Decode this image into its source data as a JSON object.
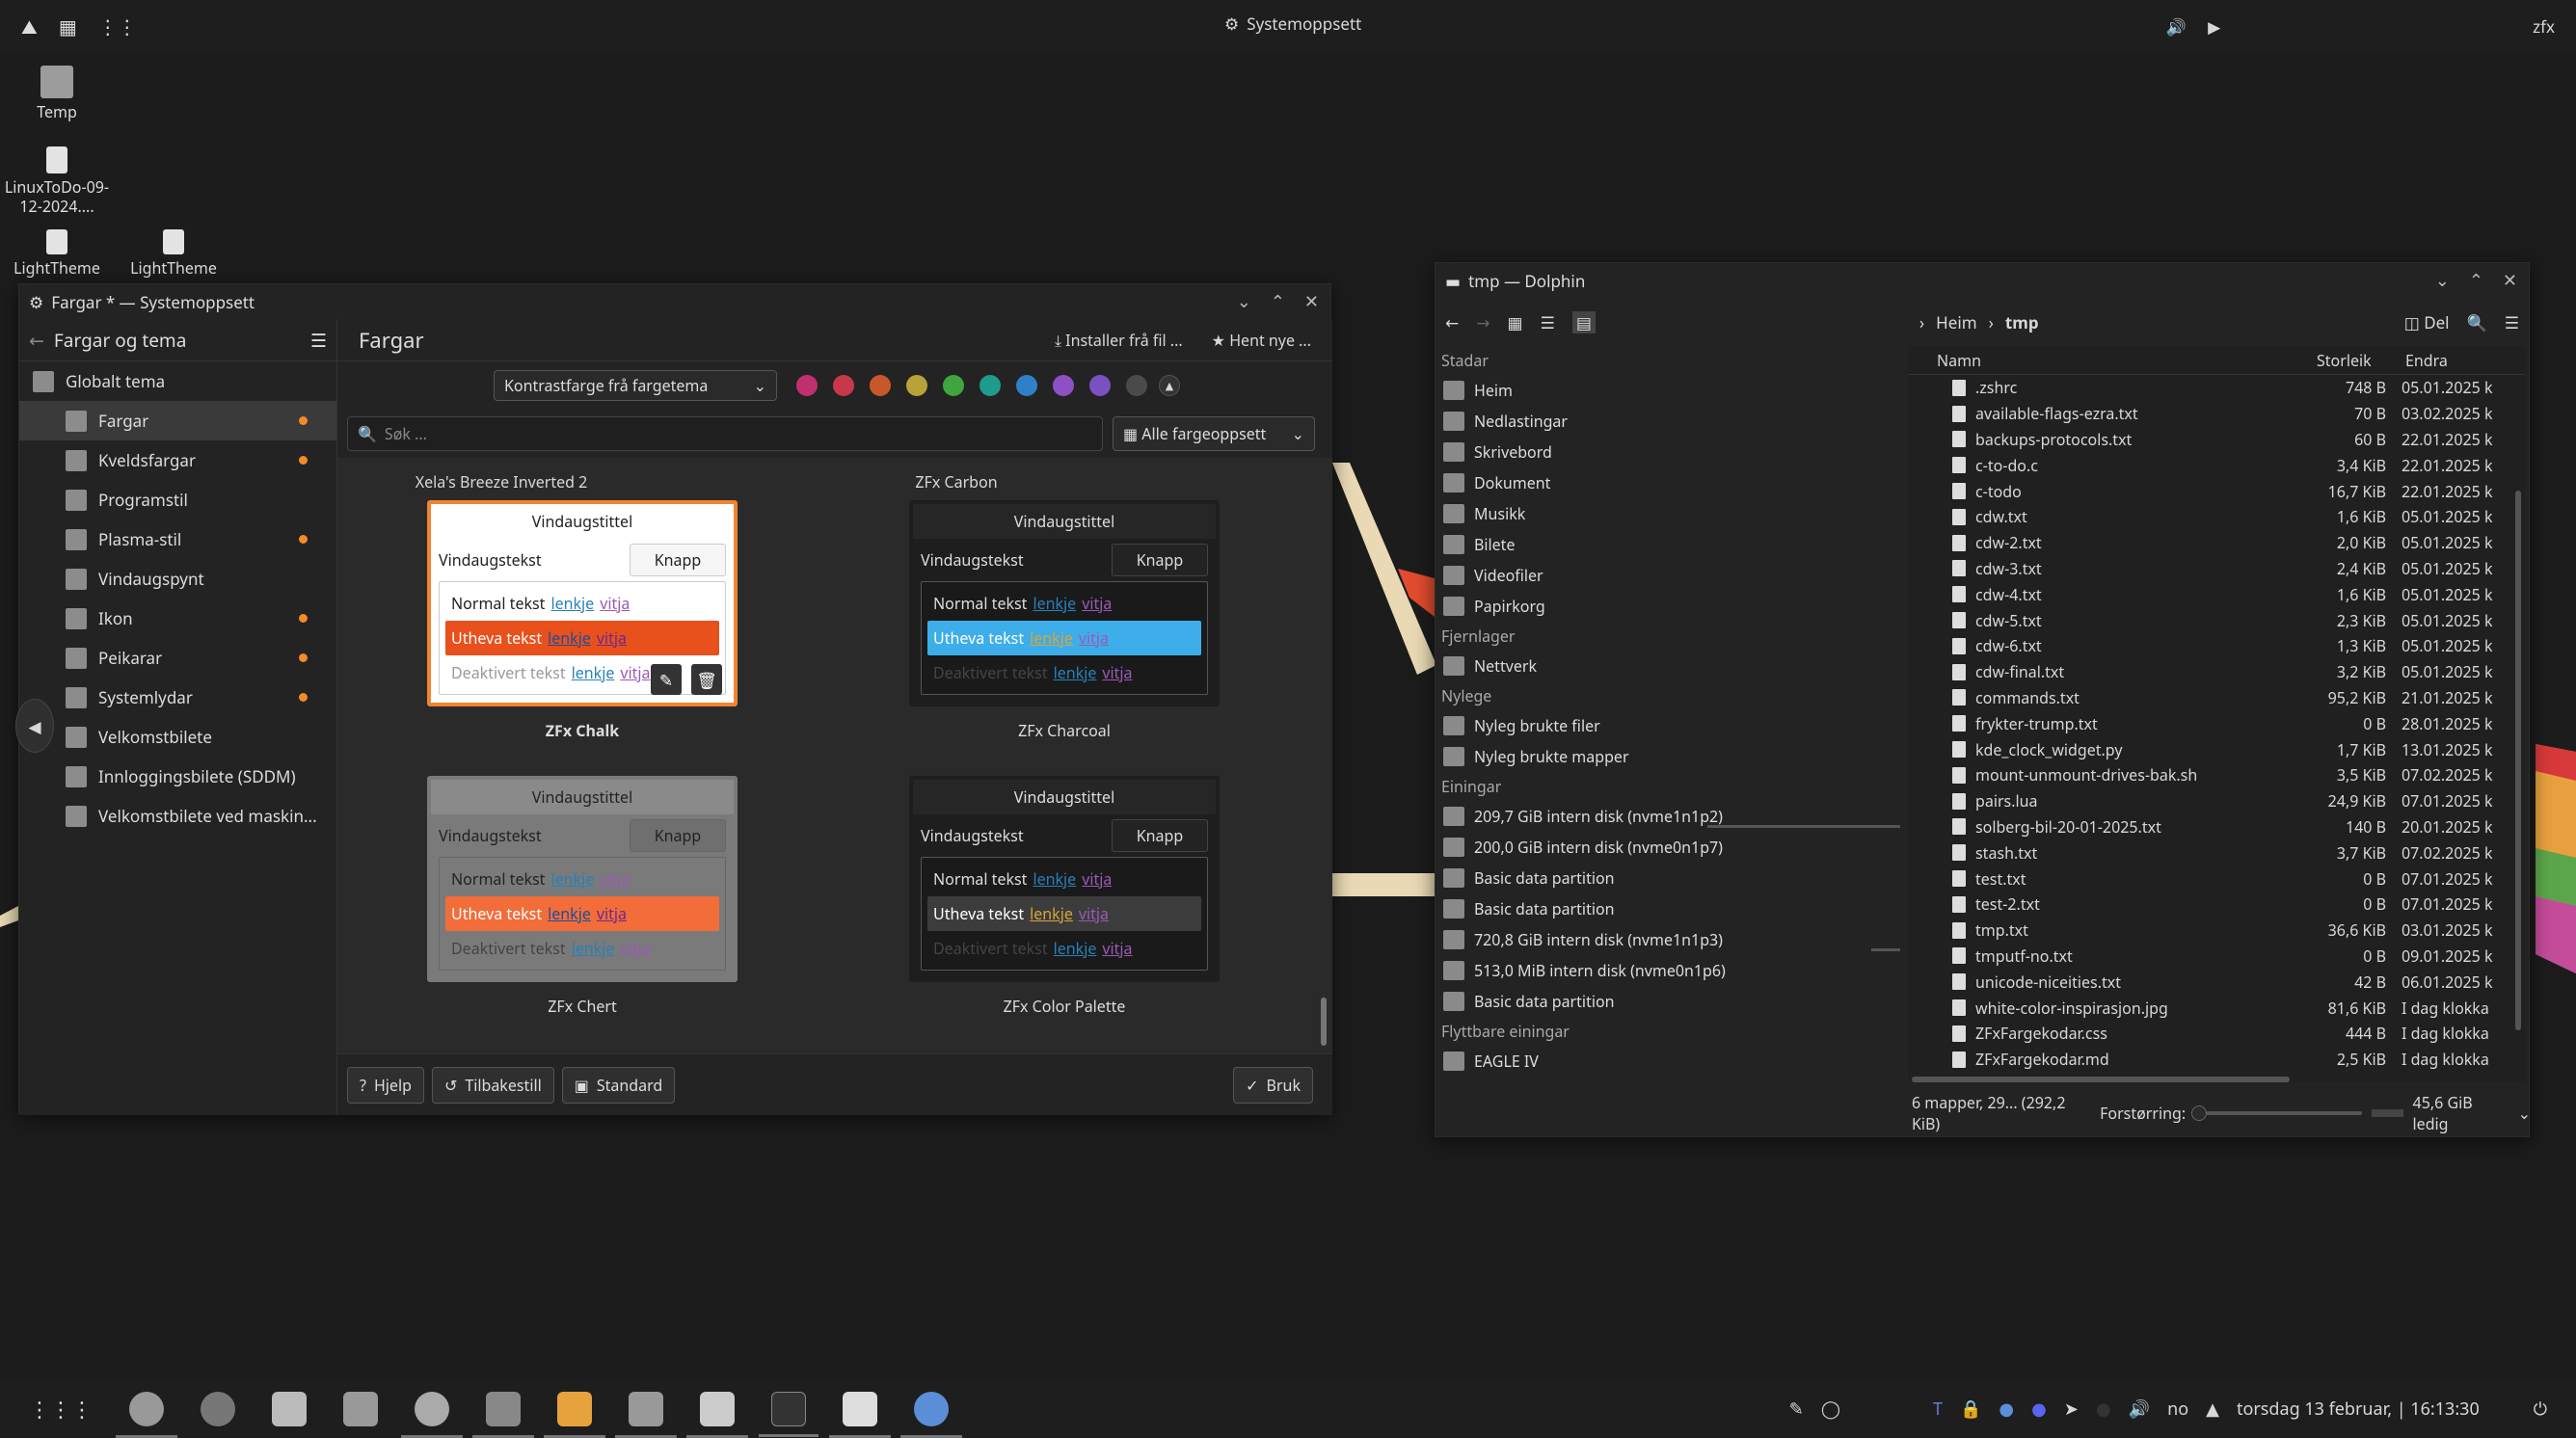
{
  "topbar": {
    "title": "Systemoppsett",
    "user": "zfx"
  },
  "desktop": {
    "icons": [
      {
        "label": "Temp"
      },
      {
        "label": "LinuxToDo-09-12-2024...."
      },
      {
        "label": "LightTheme"
      },
      {
        "label": "LightTheme"
      }
    ]
  },
  "settings": {
    "window_title": "Fargar * — Systemoppsett",
    "back_label": "Fargar og tema",
    "global": "Globalt tema",
    "items": [
      {
        "label": "Fargar",
        "modified": true
      },
      {
        "label": "Kveldsfargar",
        "modified": true
      },
      {
        "label": "Programstil",
        "modified": false
      },
      {
        "label": "Plasma-stil",
        "modified": true
      },
      {
        "label": "Vindaugspynt",
        "modified": false
      },
      {
        "label": "Ikon",
        "modified": true
      },
      {
        "label": "Peikarar",
        "modified": true
      },
      {
        "label": "Systemlydar",
        "modified": true
      },
      {
        "label": "Velkomstbilete",
        "modified": false
      },
      {
        "label": "Innloggingsbilete (SDDM)",
        "modified": false
      },
      {
        "label": "Velkomstbilete ved maskin...",
        "modified": false
      }
    ],
    "page_title": "Fargar",
    "install_label": "Installer frå fil ...",
    "get_new_label": "Hent nye ...",
    "accent_combo": "Kontrastfarge frå fargetema",
    "accent_colors": [
      "#c0306f",
      "#c7394a",
      "#c8582a",
      "#b8a338",
      "#3fa63f",
      "#1f9b8c",
      "#2f80c8",
      "#8e50c5",
      "#7a52c0",
      "#4a4a4a"
    ],
    "search_placeholder": "Søk ...",
    "filter_combo": "Alle fargeoppsett",
    "schemes_top": [
      "Xela's Breeze Inverted 2",
      "ZFx Carbon"
    ],
    "schemes": [
      {
        "name": "ZFx Chalk",
        "selected": true
      },
      {
        "name": "ZFx Charcoal",
        "selected": false
      },
      {
        "name": "ZFx Chert",
        "selected": false
      },
      {
        "name": "ZFx Color Palette",
        "selected": false
      }
    ],
    "preview": {
      "title": "Vindaugstittel",
      "text": "Vindaugstekst",
      "button": "Knapp",
      "normal": "Normal tekst",
      "highlight": "Utheva tekst",
      "disabled": "Deaktivert tekst",
      "link": "lenkje",
      "visited": "vitja"
    },
    "footer": {
      "help": "Hjelp",
      "reset": "Tilbakestill",
      "defaults": "Standard",
      "apply": "Bruk"
    }
  },
  "dolphin": {
    "window_title": "tmp — Dolphin",
    "breadcrumb": [
      "Heim",
      "tmp"
    ],
    "split_label": "Del",
    "places_sections": {
      "places": "Stadar",
      "remote": "Fjernlager",
      "recent": "Nylege",
      "devices": "Einingar",
      "removable": "Flyttbare einingar"
    },
    "places": [
      "Heim",
      "Nedlastingar",
      "Skrivebord",
      "Dokument",
      "Musikk",
      "Bilete",
      "Videofiler",
      "Papirkorg"
    ],
    "remote": [
      "Nettverk"
    ],
    "recent": [
      "Nyleg brukte filer",
      "Nyleg brukte mapper"
    ],
    "devices": [
      "209,7 GiB intern disk (nvme1n1p2)",
      "200,0 GiB intern disk (nvme0n1p7)",
      "Basic data partition",
      "Basic data partition",
      "720,8 GiB intern disk (nvme1n1p3)",
      "513,0 MiB intern disk (nvme0n1p6)",
      "Basic data partition"
    ],
    "removable": [
      "EAGLE IV"
    ],
    "columns": {
      "name": "Namn",
      "size": "Storleik",
      "modified": "Endra"
    },
    "files": [
      {
        "name": ".zshrc",
        "size": "748 B",
        "date": "05.01.2025 k"
      },
      {
        "name": "available-flags-ezra.txt",
        "size": "70 B",
        "date": "03.02.2025 k"
      },
      {
        "name": "backups-protocols.txt",
        "size": "60 B",
        "date": "22.01.2025 k"
      },
      {
        "name": "c-to-do.c",
        "size": "3,4 KiB",
        "date": "22.01.2025 k"
      },
      {
        "name": "c-todo",
        "size": "16,7 KiB",
        "date": "22.01.2025 k"
      },
      {
        "name": "cdw.txt",
        "size": "1,6 KiB",
        "date": "05.01.2025 k"
      },
      {
        "name": "cdw-2.txt",
        "size": "2,0 KiB",
        "date": "05.01.2025 k"
      },
      {
        "name": "cdw-3.txt",
        "size": "2,4 KiB",
        "date": "05.01.2025 k"
      },
      {
        "name": "cdw-4.txt",
        "size": "1,6 KiB",
        "date": "05.01.2025 k"
      },
      {
        "name": "cdw-5.txt",
        "size": "2,3 KiB",
        "date": "05.01.2025 k"
      },
      {
        "name": "cdw-6.txt",
        "size": "1,3 KiB",
        "date": "05.01.2025 k"
      },
      {
        "name": "cdw-final.txt",
        "size": "3,2 KiB",
        "date": "05.01.2025 k"
      },
      {
        "name": "commands.txt",
        "size": "95,2 KiB",
        "date": "21.01.2025 k"
      },
      {
        "name": "frykter-trump.txt",
        "size": "0 B",
        "date": "28.01.2025 k"
      },
      {
        "name": "kde_clock_widget.py",
        "size": "1,7 KiB",
        "date": "13.01.2025 k"
      },
      {
        "name": "mount-unmount-drives-bak.sh",
        "size": "3,5 KiB",
        "date": "07.02.2025 k"
      },
      {
        "name": "pairs.lua",
        "size": "24,9 KiB",
        "date": "07.01.2025 k"
      },
      {
        "name": "solberg-bil-20-01-2025.txt",
        "size": "140 B",
        "date": "20.01.2025 k"
      },
      {
        "name": "stash.txt",
        "size": "3,7 KiB",
        "date": "07.02.2025 k"
      },
      {
        "name": "test.txt",
        "size": "0 B",
        "date": "07.01.2025 k"
      },
      {
        "name": "test-2.txt",
        "size": "0 B",
        "date": "07.01.2025 k"
      },
      {
        "name": "tmp.txt",
        "size": "36,6 KiB",
        "date": "03.01.2025 k"
      },
      {
        "name": "tmputf-no.txt",
        "size": "0 B",
        "date": "09.01.2025 k"
      },
      {
        "name": "unicode-niceities.txt",
        "size": "42 B",
        "date": "06.01.2025 k"
      },
      {
        "name": "white-color-inspirasjon.jpg",
        "size": "81,6 KiB",
        "date": "I dag klokka"
      },
      {
        "name": "ZFxFargekodar.css",
        "size": "444 B",
        "date": "I dag klokka"
      },
      {
        "name": "ZFxFargekodar.md",
        "size": "2,5 KiB",
        "date": "I dag klokka"
      }
    ],
    "status": "6 mapper, 29... (292,2 KiB)",
    "zoom_label": "Forstørring:",
    "free": "45,6 GiB ledig"
  },
  "taskbar": {
    "lang": "no",
    "datetime": "torsdag 13 februar, | 16:13:30"
  }
}
